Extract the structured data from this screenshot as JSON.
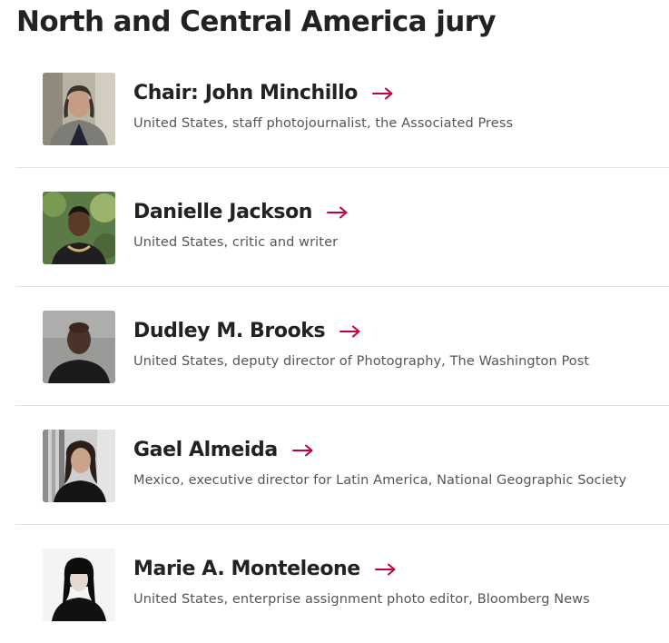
{
  "section": {
    "title": "North and Central America jury"
  },
  "accent_color": "#c4003c",
  "jury": [
    {
      "name": "Chair: John Minchillo",
      "description": "United States, staff photojournalist, the Associated Press",
      "photo": "portrait-john-minchillo"
    },
    {
      "name": "Danielle Jackson",
      "description": "United States, critic and writer",
      "photo": "portrait-danielle-jackson"
    },
    {
      "name": "Dudley M. Brooks",
      "description": "United States, deputy director of Photography, The Washington Post",
      "photo": "portrait-dudley-m-brooks"
    },
    {
      "name": "Gael Almeida",
      "description": "Mexico, executive director for Latin America, National Geographic Society",
      "photo": "portrait-gael-almeida"
    },
    {
      "name": "Marie A. Monteleone",
      "description": "United States, enterprise assignment photo editor, Bloomberg News",
      "photo": "portrait-marie-a-monteleone"
    }
  ],
  "icons": {
    "link_arrow": "arrow-right-icon"
  }
}
